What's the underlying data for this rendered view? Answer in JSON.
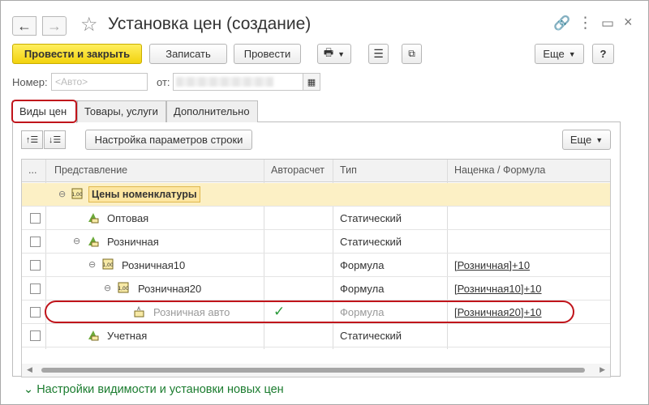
{
  "window": {
    "title": "Установка цен (создание)",
    "back_icon": "←",
    "forward_icon": "→"
  },
  "toolbar": {
    "post_and_close": "Провести и закрыть",
    "save": "Записать",
    "post": "Провести",
    "more": "Еще",
    "help": "?"
  },
  "header": {
    "number_label": "Номер:",
    "number_placeholder": "<Авто>",
    "date_label": "от:"
  },
  "tabs": [
    {
      "label": "Виды цен"
    },
    {
      "label": "Товары, услуги"
    },
    {
      "label": "Дополнительно"
    }
  ],
  "panel": {
    "row_settings_button": "Настройка параметров строки",
    "more": "Еще"
  },
  "table": {
    "columns": {
      "dots": "...",
      "name": "Представление",
      "auto": "Авторасчет",
      "type": "Тип",
      "formula": "Наценка / Формула"
    },
    "rows": [
      {
        "name": "Цены номенклатуры",
        "type": "",
        "formula": ""
      },
      {
        "name": "Оптовая",
        "type": "Статический",
        "formula": ""
      },
      {
        "name": "Розничная",
        "type": "Статический",
        "formula": ""
      },
      {
        "name": "Розничная10",
        "type": "Формула",
        "formula": "[Розничная]+10"
      },
      {
        "name": "Розничная20",
        "type": "Формула",
        "formula": "[Розничная10]+10"
      },
      {
        "name": "Розничная авто",
        "type": "Формула",
        "formula": "[Розничная20]+10",
        "auto": "✓"
      },
      {
        "name": "Учетная",
        "type": "Статический",
        "formula": ""
      }
    ]
  },
  "footer": {
    "settings_link": "Настройки видимости и установки новых цен"
  },
  "colors": {
    "accent_yellow": "#f5d829",
    "highlight_red": "#c0141b",
    "link_green": "#1b7c2f",
    "group_row": "#fcf0c5"
  }
}
